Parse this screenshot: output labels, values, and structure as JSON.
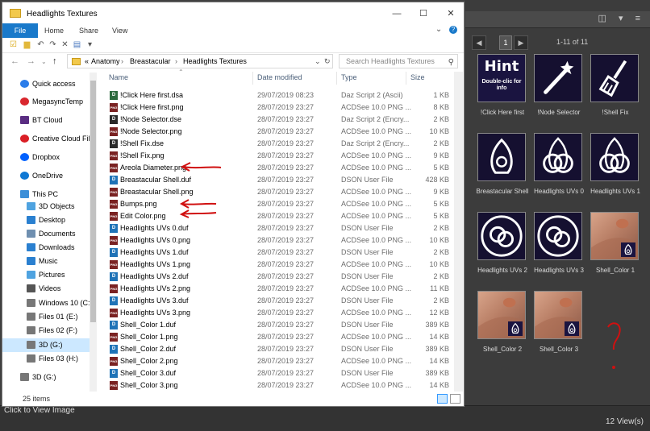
{
  "explorer": {
    "title": "Headlights Textures",
    "window_controls": [
      "—",
      "☐",
      "✕"
    ],
    "ribbon_tabs": [
      "File",
      "Home",
      "Share",
      "View"
    ],
    "address": {
      "prefix": "«",
      "segments": [
        "Anatomy",
        "Breastacular",
        "Headlights Textures"
      ]
    },
    "search_placeholder": "Search Headlights Textures",
    "columns": {
      "name": "Name",
      "date": "Date modified",
      "type": "Type",
      "size": "Size"
    },
    "nav_items": [
      {
        "label": "Quick access",
        "icon": "star-icon",
        "color": "#2b7de9"
      },
      {
        "label": "MegasyncTemp",
        "icon": "mega-icon",
        "color": "#d9272e"
      },
      {
        "label": "BT Cloud",
        "icon": "bt-cloud-icon",
        "color": "#5a2d82"
      },
      {
        "label": "Creative Cloud Fil",
        "icon": "creative-cloud-icon",
        "color": "#da1f26"
      },
      {
        "label": "Dropbox",
        "icon": "dropbox-icon",
        "color": "#0061fe"
      },
      {
        "label": "OneDrive",
        "icon": "onedrive-icon",
        "color": "#0f78d4"
      },
      {
        "label": "This PC",
        "icon": "pc-icon",
        "color": "#3c8fd8"
      },
      {
        "label": "3D Objects",
        "icon": "3d-objects-icon",
        "color": "#4fa3e0"
      },
      {
        "label": "Desktop",
        "icon": "desktop-icon",
        "color": "#2a80d0"
      },
      {
        "label": "Documents",
        "icon": "documents-icon",
        "color": "#6f8fb0"
      },
      {
        "label": "Downloads",
        "icon": "downloads-icon",
        "color": "#2a80d0"
      },
      {
        "label": "Music",
        "icon": "music-icon",
        "color": "#2a80d0"
      },
      {
        "label": "Pictures",
        "icon": "pictures-icon",
        "color": "#4fa3e0"
      },
      {
        "label": "Videos",
        "icon": "videos-icon",
        "color": "#555555"
      },
      {
        "label": "Windows 10 (C:)",
        "icon": "drive-icon",
        "color": "#777777"
      },
      {
        "label": "Files 01 (E:)",
        "icon": "drive-icon",
        "color": "#777777"
      },
      {
        "label": "Files 02 (F:)",
        "icon": "drive-icon",
        "color": "#777777"
      },
      {
        "label": "3D (G:)",
        "icon": "drive-icon",
        "color": "#777777"
      },
      {
        "label": "Files 03 (H:)",
        "icon": "drive-icon",
        "color": "#777777"
      },
      {
        "label": "3D (G:)",
        "icon": "drive-icon",
        "color": "#777777"
      }
    ],
    "files": [
      {
        "name": "!Click Here first.dsa",
        "date": "29/07/2019 08:23",
        "type": "Daz Script 2 (Ascii)",
        "size": "1 KB",
        "icon": "dsa"
      },
      {
        "name": "!Click Here first.png",
        "date": "28/07/2019 23:27",
        "type": "ACDSee 10.0 PNG ...",
        "size": "8 KB",
        "icon": "png"
      },
      {
        "name": "!Node Selector.dse",
        "date": "28/07/2019 23:27",
        "type": "Daz Script 2 (Encry...",
        "size": "2 KB",
        "icon": "dse"
      },
      {
        "name": "!Node Selector.png",
        "date": "28/07/2019 23:27",
        "type": "ACDSee 10.0 PNG ...",
        "size": "10 KB",
        "icon": "png"
      },
      {
        "name": "!Shell Fix.dse",
        "date": "28/07/2019 23:27",
        "type": "Daz Script 2 (Encry...",
        "size": "2 KB",
        "icon": "dse"
      },
      {
        "name": "!Shell Fix.png",
        "date": "28/07/2019 23:27",
        "type": "ACDSee 10.0 PNG ...",
        "size": "9 KB",
        "icon": "png"
      },
      {
        "name": "Areola Diameter.png",
        "date": "28/07/2019 23:27",
        "type": "ACDSee 10.0 PNG ...",
        "size": "5 KB",
        "icon": "png"
      },
      {
        "name": "Breastacular Shell.duf",
        "date": "28/07/2019 23:27",
        "type": "DSON User File",
        "size": "428 KB",
        "icon": "duf"
      },
      {
        "name": "Breastacular Shell.png",
        "date": "28/07/2019 23:27",
        "type": "ACDSee 10.0 PNG ...",
        "size": "9 KB",
        "icon": "png"
      },
      {
        "name": "Bumps.png",
        "date": "28/07/2019 23:27",
        "type": "ACDSee 10.0 PNG ...",
        "size": "5 KB",
        "icon": "png"
      },
      {
        "name": "Edit Color.png",
        "date": "28/07/2019 23:27",
        "type": "ACDSee 10.0 PNG ...",
        "size": "5 KB",
        "icon": "png"
      },
      {
        "name": "Headlights UVs 0.duf",
        "date": "28/07/2019 23:27",
        "type": "DSON User File",
        "size": "2 KB",
        "icon": "duf"
      },
      {
        "name": "Headlights UVs 0.png",
        "date": "28/07/2019 23:27",
        "type": "ACDSee 10.0 PNG ...",
        "size": "10 KB",
        "icon": "png"
      },
      {
        "name": "Headlights UVs 1.duf",
        "date": "28/07/2019 23:27",
        "type": "DSON User File",
        "size": "2 KB",
        "icon": "duf"
      },
      {
        "name": "Headlights UVs 1.png",
        "date": "28/07/2019 23:27",
        "type": "ACDSee 10.0 PNG ...",
        "size": "10 KB",
        "icon": "png"
      },
      {
        "name": "Headlights UVs 2.duf",
        "date": "28/07/2019 23:27",
        "type": "DSON User File",
        "size": "2 KB",
        "icon": "duf"
      },
      {
        "name": "Headlights UVs 2.png",
        "date": "28/07/2019 23:27",
        "type": "ACDSee 10.0 PNG ...",
        "size": "11 KB",
        "icon": "png"
      },
      {
        "name": "Headlights UVs 3.duf",
        "date": "28/07/2019 23:27",
        "type": "DSON User File",
        "size": "2 KB",
        "icon": "duf"
      },
      {
        "name": "Headlights UVs 3.png",
        "date": "28/07/2019 23:27",
        "type": "ACDSee 10.0 PNG ...",
        "size": "12 KB",
        "icon": "png"
      },
      {
        "name": "Shell_Color 1.duf",
        "date": "28/07/2019 23:27",
        "type": "DSON User File",
        "size": "389 KB",
        "icon": "duf"
      },
      {
        "name": "Shell_Color 1.png",
        "date": "28/07/2019 23:27",
        "type": "ACDSee 10.0 PNG ...",
        "size": "14 KB",
        "icon": "png"
      },
      {
        "name": "Shell_Color 2.duf",
        "date": "28/07/2019 23:27",
        "type": "DSON User File",
        "size": "389 KB",
        "icon": "duf"
      },
      {
        "name": "Shell_Color 2.png",
        "date": "28/07/2019 23:27",
        "type": "ACDSee 10.0 PNG ...",
        "size": "14 KB",
        "icon": "png"
      },
      {
        "name": "Shell_Color 3.duf",
        "date": "28/07/2019 23:27",
        "type": "DSON User File",
        "size": "389 KB",
        "icon": "duf"
      },
      {
        "name": "Shell_Color 3.png",
        "date": "28/07/2019 23:27",
        "type": "ACDSee 10.0 PNG ...",
        "size": "14 KB",
        "icon": "png"
      }
    ],
    "item_count": "25 items"
  },
  "daz": {
    "page_number": "1",
    "range_text": "1-11 of 11",
    "tiles": [
      {
        "label": "!Click Here first",
        "kind": "hint",
        "hint_title": "Hint",
        "hint_sub": "Double-clic for info"
      },
      {
        "label": "!Node Selector",
        "kind": "wand"
      },
      {
        "label": "!Shell Fix",
        "kind": "brush"
      },
      {
        "label": "Breastacular Shell",
        "kind": "shell"
      },
      {
        "label": "Headlights UVs 0",
        "kind": "rings"
      },
      {
        "label": "Headlights UVs 1",
        "kind": "rings"
      },
      {
        "label": "Headlights UVs 2",
        "kind": "knot"
      },
      {
        "label": "Headlights UVs 3",
        "kind": "knot"
      },
      {
        "label": "Shell_Color 1",
        "kind": "skin"
      },
      {
        "label": "Shell_Color 2",
        "kind": "skin"
      },
      {
        "label": "Shell_Color 3",
        "kind": "skin"
      }
    ],
    "annotation_question": "?",
    "status_left": "Click to View Image",
    "status_right": "12 View(s)"
  },
  "colors": {
    "accent": "#1979ca",
    "annotation_red": "#d01010",
    "dsa_icon": "#2d6a3e",
    "dse_icon": "#2a2a2a",
    "duf_icon": "#1f73b7",
    "png_icon": "#7a2222"
  }
}
